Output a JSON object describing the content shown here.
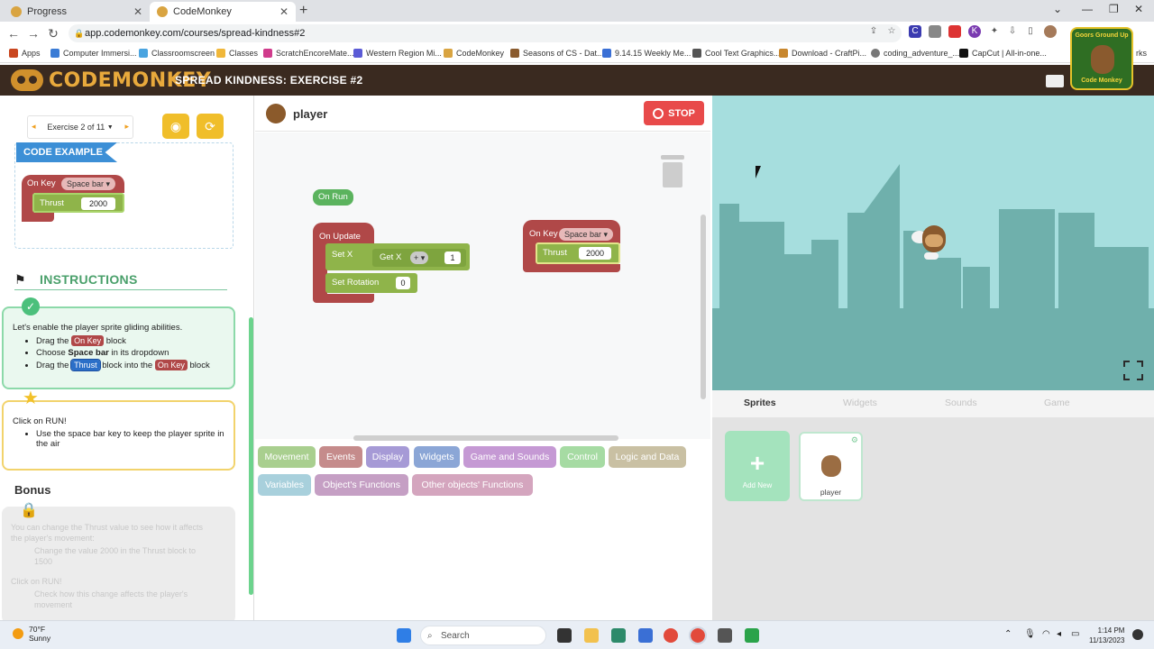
{
  "browser": {
    "tabs": [
      {
        "title": "Progress",
        "active": false
      },
      {
        "title": "CodeMonkey",
        "active": true
      }
    ],
    "url": "app.codemonkey.com/courses/spread-kindness#2",
    "bookmarks": [
      "Apps",
      "Computer Immersi...",
      "Classroomscreen",
      "Classes",
      "ScratchEncoreMate...",
      "Western Region Mi...",
      "CodeMonkey",
      "Seasons of CS - Dat...",
      "9.14.15 Weekly Me...",
      "Cool Text Graphics...",
      "Download - CraftPi...",
      "coding_adventure_...",
      "CapCut | All-in-one...",
      "rks"
    ]
  },
  "app": {
    "logo_text": "CODEMONKEY",
    "exercise_title": "SPREAD KINDNESS: EXERCISE #2",
    "badge_top": "Goors Ground Up",
    "badge_bottom": "Code Monkey"
  },
  "left": {
    "exercise_selector": "Exercise 2 of 11",
    "code_example_label": "CODE EXAMPLE",
    "code_example": {
      "on_key": "On Key",
      "key": "Space bar",
      "thrust": "Thrust",
      "thrust_value": "2000"
    },
    "instructions_title": "INSTRUCTIONS",
    "step1": {
      "intro": "Let's enable the player sprite gliding abilities.",
      "bullets": [
        {
          "pre": "Drag the ",
          "kw": "On Key",
          "post": " block"
        },
        {
          "pre": "Choose ",
          "bold": "Space bar",
          "post": " in its dropdown"
        },
        {
          "pre": "Drag the ",
          "kw": "Thrust",
          "mid": " block into the ",
          "kw2": "On Key",
          "post": " block"
        }
      ]
    },
    "step2": {
      "intro": "Click on RUN!",
      "bullets": [
        "Use the space bar key to keep the player sprite in the air"
      ]
    },
    "bonus_title": "Bonus",
    "bonus_lines": [
      "You can change the Thrust value to see how it affects",
      "the player's movement:",
      "Change the value 2000 in the Thrust block to",
      "1500",
      "Click on RUN!",
      "Check how this change affects the player's",
      "movement"
    ]
  },
  "editor": {
    "sprite_name": "player",
    "stop_label": "STOP",
    "blocks": {
      "on_run": "On Run",
      "on_update": "On Update",
      "set_x": "Set X",
      "get_x": "Get X",
      "op": "+",
      "op_value": "1",
      "set_rotation": "Set Rotation",
      "rotation_value": "0",
      "on_key": "On Key",
      "key": "Space bar",
      "thrust": "Thrust",
      "thrust_value": "2000"
    },
    "palette": [
      {
        "label": "Movement",
        "color": "#a9cf8f"
      },
      {
        "label": "Events",
        "color": "#c58b8b"
      },
      {
        "label": "Display",
        "color": "#a69ad6"
      },
      {
        "label": "Widgets",
        "color": "#8ba6d6"
      },
      {
        "label": "Game and Sounds",
        "color": "#c599d4"
      },
      {
        "label": "Control",
        "color": "#a6dba3"
      },
      {
        "label": "Logic and Data",
        "color": "#c9c0a3"
      },
      {
        "label": "Variables",
        "color": "#a8d0dc"
      },
      {
        "label": "Object's Functions",
        "color": "#c59fc4"
      },
      {
        "label": "Other objects' Functions",
        "color": "#d4a5be"
      }
    ]
  },
  "right": {
    "tabs": [
      "Sprites",
      "Widgets",
      "Sounds",
      "Game"
    ],
    "active_tab": "Sprites",
    "add_new": "Add New",
    "sprite_card": "player"
  },
  "taskbar": {
    "weather_temp": "70°F",
    "weather_desc": "Sunny",
    "search_placeholder": "Search",
    "time": "1:14 PM",
    "date": "11/13/2023"
  },
  "colors": {
    "header_bg": "#3a2a20",
    "logo": "#e8a93c",
    "stage_sky": "#a6dede",
    "stage_buildings": "#6fb0ac",
    "stop": "#e84a4a",
    "event_block": "#b04848",
    "movement_block": "#8fb44a"
  }
}
